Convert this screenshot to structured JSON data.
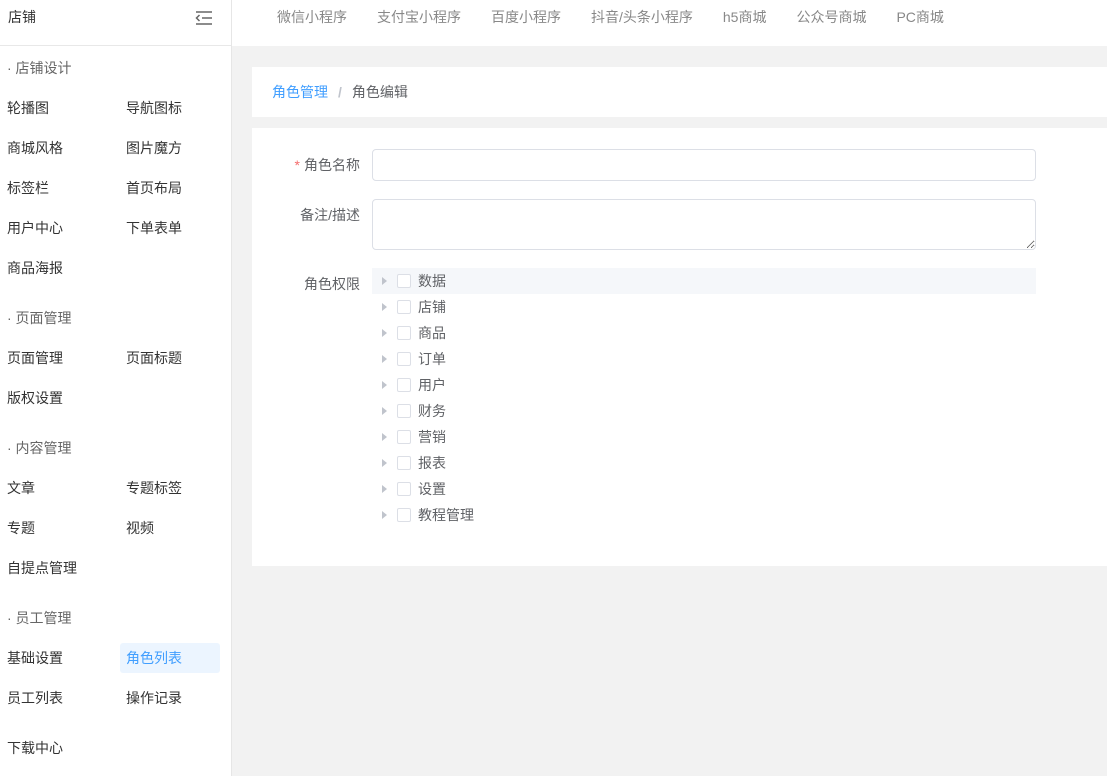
{
  "colors": {
    "accent": "#409eff",
    "required": "#f56c6c",
    "active_bg": "#ecf5ff",
    "page_bg": "#f2f2f2",
    "row_highlight_bg": "#f5f7fa"
  },
  "icons": {
    "sidebar_toggle": "menu-fold-icon",
    "tree_expand": "caret-right-icon",
    "tree_checkbox": "checkbox-icon"
  },
  "sidebar": {
    "title": "店铺",
    "sections": [
      {
        "title": "· 店铺设计",
        "items": [
          {
            "label": "轮播图"
          },
          {
            "label": "导航图标"
          },
          {
            "label": "商城风格"
          },
          {
            "label": "图片魔方"
          },
          {
            "label": "标签栏"
          },
          {
            "label": "首页布局"
          },
          {
            "label": "用户中心"
          },
          {
            "label": "下单表单"
          },
          {
            "label": "商品海报"
          }
        ]
      },
      {
        "title": "· 页面管理",
        "items": [
          {
            "label": "页面管理"
          },
          {
            "label": "页面标题"
          },
          {
            "label": "版权设置"
          }
        ]
      },
      {
        "title": "· 内容管理",
        "items": [
          {
            "label": "文章"
          },
          {
            "label": "专题标签"
          },
          {
            "label": "专题"
          },
          {
            "label": "视频"
          },
          {
            "label": "自提点管理"
          }
        ]
      },
      {
        "title": "· 员工管理",
        "items": [
          {
            "label": "基础设置"
          },
          {
            "label": "角色列表",
            "active": true
          },
          {
            "label": "员工列表"
          },
          {
            "label": "操作记录"
          }
        ]
      }
    ],
    "footer_item": {
      "label": "下载中心"
    }
  },
  "topnav": {
    "tabs": [
      "微信小程序",
      "支付宝小程序",
      "百度小程序",
      "抖音/头条小程序",
      "h5商城",
      "公众号商城",
      "PC商城"
    ]
  },
  "breadcrumb": {
    "parent": "角色管理",
    "separator": "/",
    "current": "角色编辑"
  },
  "form": {
    "name": {
      "required_mark": "*",
      "label": "角色名称",
      "value": ""
    },
    "remark": {
      "label": "备注/描述",
      "value": ""
    },
    "permissions": {
      "label": "角色权限",
      "nodes": [
        {
          "label": "数据",
          "checked": false,
          "current": true
        },
        {
          "label": "店铺",
          "checked": false
        },
        {
          "label": "商品",
          "checked": false
        },
        {
          "label": "订单",
          "checked": false
        },
        {
          "label": "用户",
          "checked": false
        },
        {
          "label": "财务",
          "checked": false
        },
        {
          "label": "营销",
          "checked": false
        },
        {
          "label": "报表",
          "checked": false
        },
        {
          "label": "设置",
          "checked": false
        },
        {
          "label": "教程管理",
          "checked": false
        }
      ]
    }
  }
}
